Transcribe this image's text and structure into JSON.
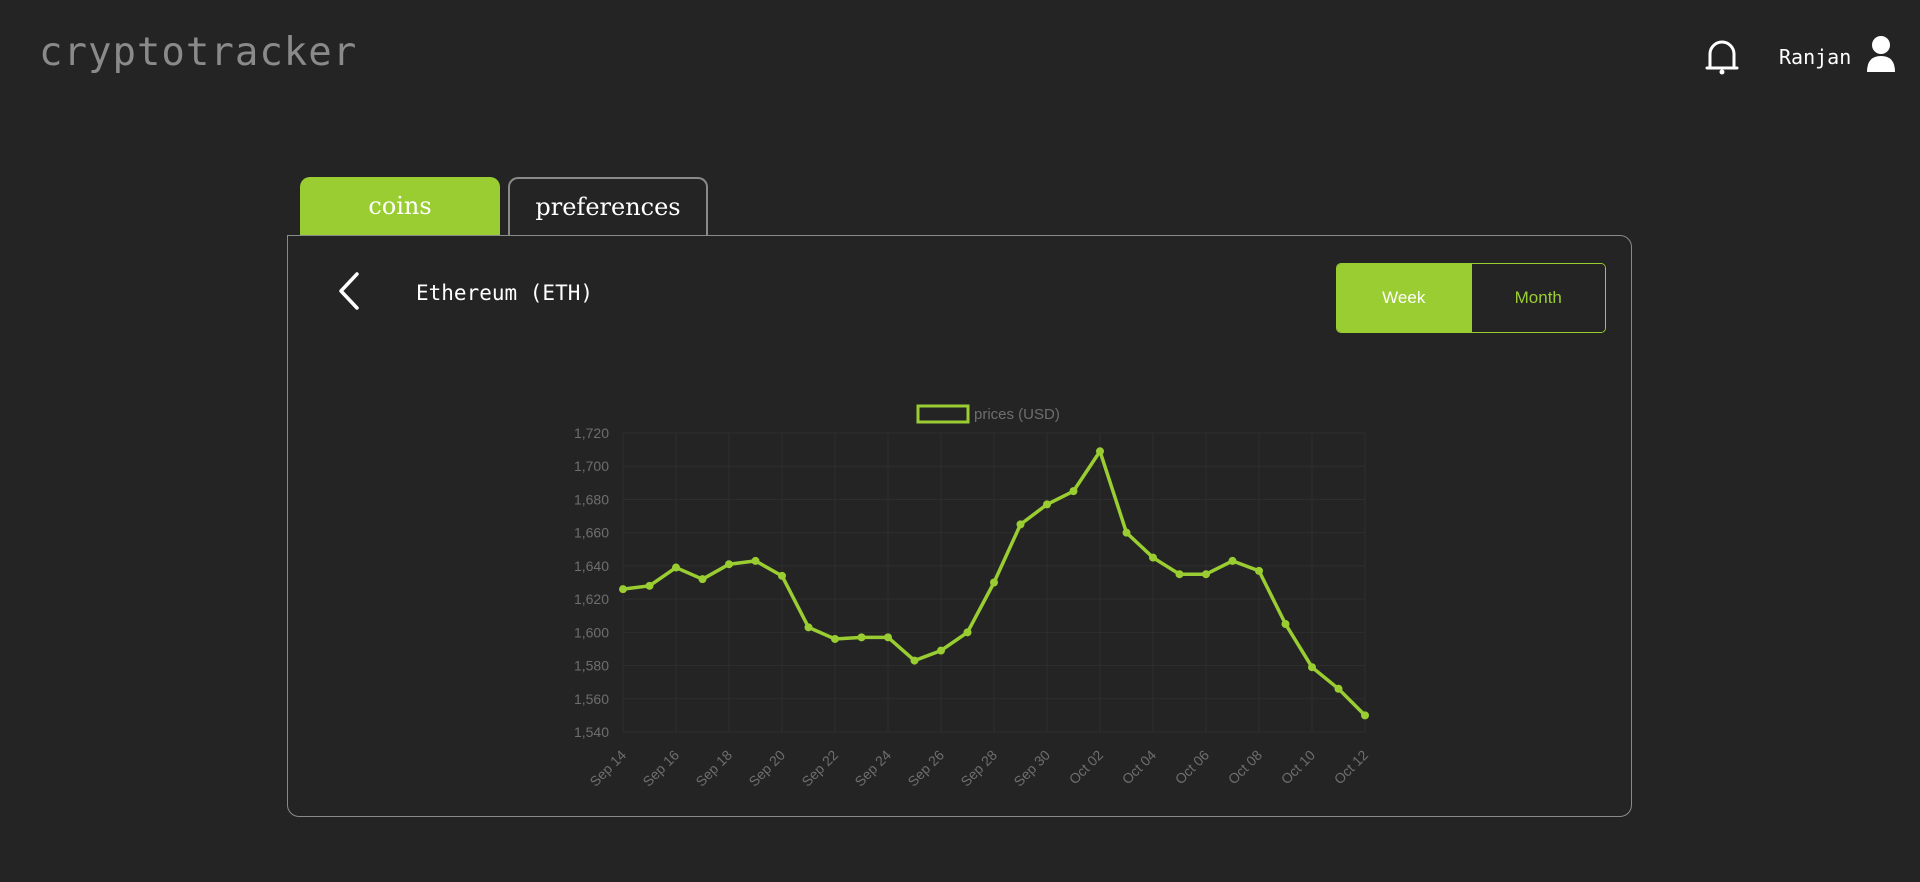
{
  "header": {
    "logo": "cryptotracker",
    "username": "Ranjan",
    "bell_icon": "bell-icon",
    "user_icon": "user-icon"
  },
  "tabs": [
    {
      "label": "coins",
      "active": true
    },
    {
      "label": "preferences",
      "active": false
    }
  ],
  "panel": {
    "coin_name": "Ethereum (ETH)",
    "back_icon": "chevron-left-icon",
    "range_options": [
      "Week",
      "Month"
    ],
    "range_selected": "Week"
  },
  "colors": {
    "accent": "#9acd32",
    "background": "#242424",
    "border": "#8a8a8a",
    "axis_text": "#6e6e6e"
  },
  "chart_data": {
    "type": "line",
    "legend": "prices (USD)",
    "legend_position": "top",
    "grid": true,
    "ylim": [
      1540,
      1720
    ],
    "y_ticks": [
      1540,
      1560,
      1580,
      1600,
      1620,
      1640,
      1660,
      1680,
      1700,
      1720
    ],
    "y_tick_labels": [
      "1,540",
      "1,560",
      "1,580",
      "1,600",
      "1,620",
      "1,640",
      "1,660",
      "1,680",
      "1,700",
      "1,720"
    ],
    "x_tick_labels": [
      "Sep 14",
      "Sep 16",
      "Sep 18",
      "Sep 20",
      "Sep 22",
      "Sep 24",
      "Sep 26",
      "Sep 28",
      "Sep 30",
      "Oct 02",
      "Oct 04",
      "Oct 06",
      "Oct 08",
      "Oct 10",
      "Oct 12"
    ],
    "x": [
      "Sep 14",
      "Sep 15",
      "Sep 16",
      "Sep 17",
      "Sep 18",
      "Sep 19",
      "Sep 20",
      "Sep 21",
      "Sep 22",
      "Sep 23",
      "Sep 24",
      "Sep 25",
      "Sep 26",
      "Sep 27",
      "Sep 28",
      "Sep 29",
      "Sep 30",
      "Oct 01",
      "Oct 02",
      "Oct 03",
      "Oct 04",
      "Oct 05",
      "Oct 06",
      "Oct 07",
      "Oct 08",
      "Oct 09",
      "Oct 10",
      "Oct 11",
      "Oct 12"
    ],
    "series": [
      {
        "name": "prices (USD)",
        "values": [
          1626,
          1628,
          1639,
          1632,
          1641,
          1643,
          1634,
          1603,
          1596,
          1597,
          1597,
          1583,
          1589,
          1600,
          1630,
          1665,
          1677,
          1685,
          1709,
          1660,
          1645,
          1635,
          1635,
          1643,
          1637,
          1605,
          1579,
          1566,
          1550
        ]
      }
    ]
  }
}
